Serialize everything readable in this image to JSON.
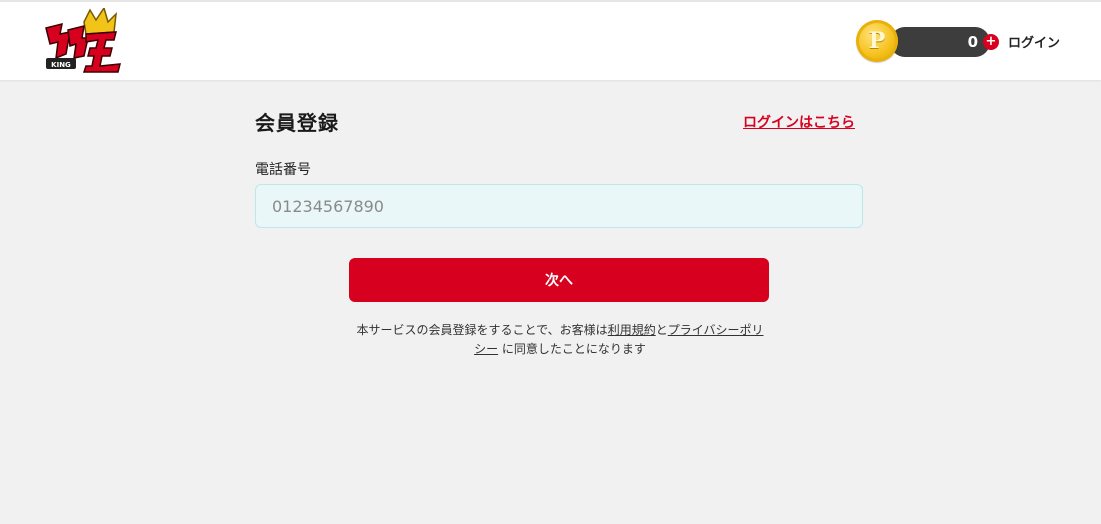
{
  "header": {
    "logo": {
      "text": "ガチャ王",
      "sub": "KING",
      "icon": "crown-logo-icon"
    },
    "points": {
      "coin_letter": "P",
      "balance": "0",
      "add_symbol": "+"
    },
    "login_label": "ログイン"
  },
  "form": {
    "title": "会員登録",
    "login_link": "ログインはこちら",
    "phone_label": "電話番号",
    "phone_value": "",
    "phone_placeholder": "01234567890",
    "next_button": "次へ"
  },
  "terms": {
    "prefix": "本サービスの会員登録をすることで、お客様は",
    "terms_link": "利用規約",
    "and": "と",
    "privacy_link": "プライバシーポリシー",
    "suffix": " に同意したことになります"
  },
  "colors": {
    "accent": "#d7001f",
    "background": "#f1f1f1",
    "input_bg": "#eaf7f8",
    "coin": "#f5c11c",
    "pill": "#3d3d3d"
  }
}
